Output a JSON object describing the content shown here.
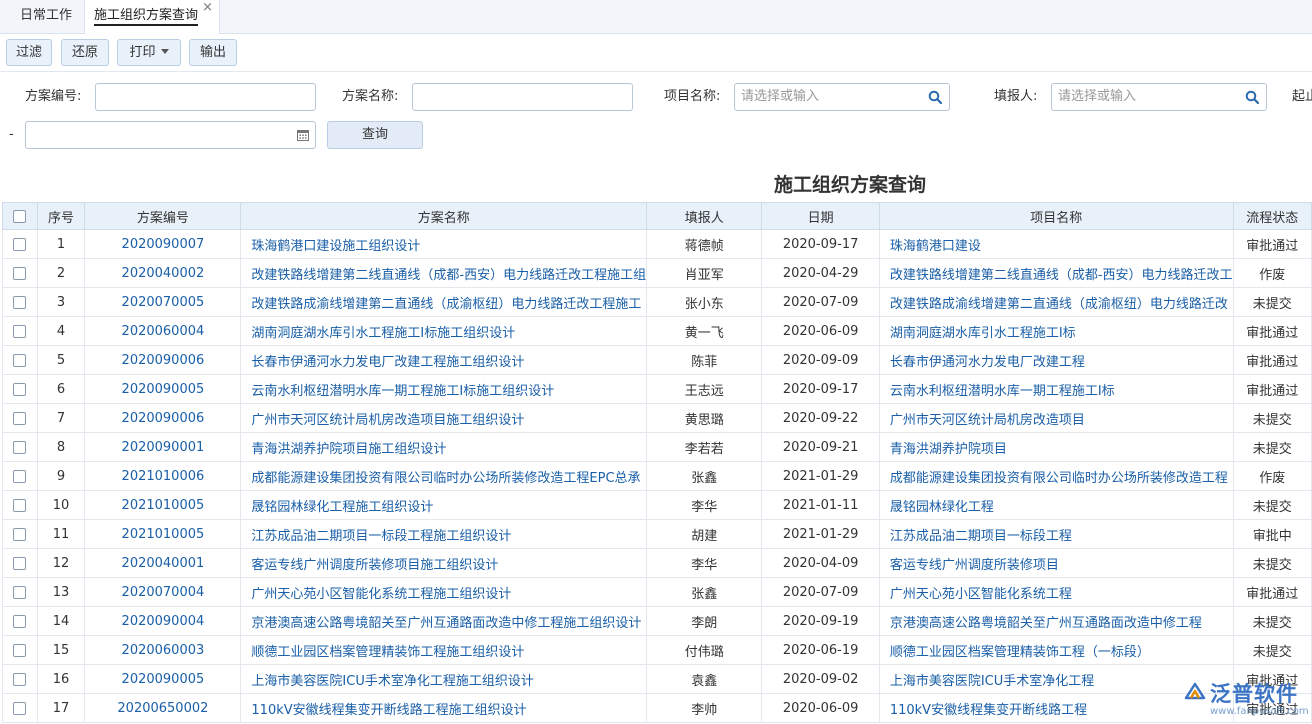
{
  "tabs": [
    {
      "label": "日常工作"
    },
    {
      "label": "施工组织方案查询",
      "close": "×"
    }
  ],
  "toolbar": {
    "filter": "过滤",
    "reset": "还原",
    "print": "打印",
    "output": "输出"
  },
  "form": {
    "plan_no_label": "方案编号:",
    "plan_name_label": "方案名称:",
    "project_label": "项目名称:",
    "project_placeholder": "请选择或输入",
    "reporter_label": "填报人:",
    "reporter_placeholder": "请选择或输入",
    "start_label": "起止",
    "dash": "-",
    "query": "查询"
  },
  "title": "施工组织方案查询",
  "columns": [
    "序号",
    "方案编号",
    "方案名称",
    "填报人",
    "日期",
    "项目名称",
    "流程状态"
  ],
  "rows": [
    {
      "no": "1",
      "code": "2020090007",
      "name": "珠海鹤港口建设施工组织设计",
      "reporter": "蒋德帧",
      "date": "2020-09-17",
      "project": "珠海鹤港口建设",
      "status": "审批通过",
      "status_type": "approved"
    },
    {
      "no": "2",
      "code": "2020040002",
      "name": "改建铁路线增建第二线直通线（成都-西安）电力线路迁改工程施工组",
      "reporter": "肖亚军",
      "date": "2020-04-29",
      "project": "改建铁路线增建第二线直通线（成都-西安）电力线路迁改工",
      "status": "作废",
      "status_type": "void"
    },
    {
      "no": "3",
      "code": "2020070005",
      "name": "改建铁路成渝线增建第二直通线（成渝枢纽）电力线路迁改工程施工",
      "reporter": "张小东",
      "date": "2020-07-09",
      "project": "改建铁路成渝线增建第二直通线（成渝枢纽）电力线路迁改",
      "status": "未提交",
      "status_type": "unsub"
    },
    {
      "no": "4",
      "code": "2020060004",
      "name": "湖南洞庭湖水库引水工程施工I标施工组织设计",
      "reporter": "黄一飞",
      "date": "2020-06-09",
      "project": "湖南洞庭湖水库引水工程施工I标",
      "status": "审批通过",
      "status_type": "approved"
    },
    {
      "no": "5",
      "code": "2020090006",
      "name": "长春市伊通河水力发电厂改建工程施工组织设计",
      "reporter": "陈菲",
      "date": "2020-09-09",
      "project": "长春市伊通河水力发电厂改建工程",
      "status": "审批通过",
      "status_type": "approved"
    },
    {
      "no": "6",
      "code": "2020090005",
      "name": "云南水利枢纽潜明水库一期工程施工I标施工组织设计",
      "reporter": "王志远",
      "date": "2020-09-17",
      "project": "云南水利枢纽潜明水库一期工程施工I标",
      "status": "审批通过",
      "status_type": "approved"
    },
    {
      "no": "7",
      "code": "2020090006",
      "name": "广州市天河区统计局机房改造项目施工组织设计",
      "reporter": "黄思璐",
      "date": "2020-09-22",
      "project": "广州市天河区统计局机房改造项目",
      "status": "未提交",
      "status_type": "unsub"
    },
    {
      "no": "8",
      "code": "2020090001",
      "name": "青海洪湖养护院项目施工组织设计",
      "reporter": "李若若",
      "date": "2020-09-21",
      "project": "青海洪湖养护院项目",
      "status": "未提交",
      "status_type": "unsub"
    },
    {
      "no": "9",
      "code": "2021010006",
      "name": "成都能源建设集团投资有限公司临时办公场所装修改造工程EPC总承",
      "reporter": "张鑫",
      "date": "2021-01-29",
      "project": "成都能源建设集团投资有限公司临时办公场所装修改造工程",
      "status": "作废",
      "status_type": "void"
    },
    {
      "no": "10",
      "code": "2021010005",
      "name": "晟铭园林绿化工程施工组织设计",
      "reporter": "李华",
      "date": "2021-01-11",
      "project": "晟铭园林绿化工程",
      "status": "未提交",
      "status_type": "unsub"
    },
    {
      "no": "11",
      "code": "2021010005",
      "name": "江苏成品油二期项目一标段工程施工组织设计",
      "reporter": "胡建",
      "date": "2021-01-29",
      "project": "江苏成品油二期项目一标段工程",
      "status": "审批中",
      "status_type": "pending"
    },
    {
      "no": "12",
      "code": "2020040001",
      "name": "客运专线广州调度所装修项目施工组织设计",
      "reporter": "李华",
      "date": "2020-04-09",
      "project": "客运专线广州调度所装修项目",
      "status": "未提交",
      "status_type": "unsub"
    },
    {
      "no": "13",
      "code": "2020070004",
      "name": "广州天心苑小区智能化系统工程施工组织设计",
      "reporter": "张鑫",
      "date": "2020-07-09",
      "project": "广州天心苑小区智能化系统工程",
      "status": "审批通过",
      "status_type": "approved"
    },
    {
      "no": "14",
      "code": "2020090004",
      "name": "京港澳高速公路粤境韶关至广州互通路面改造中修工程施工组织设计",
      "reporter": "李朗",
      "date": "2020-09-19",
      "project": "京港澳高速公路粤境韶关至广州互通路面改造中修工程",
      "status": "未提交",
      "status_type": "unsub"
    },
    {
      "no": "15",
      "code": "2020060003",
      "name": "顺德工业园区档案管理精装饰工程施工组织设计",
      "reporter": "付伟璐",
      "date": "2020-06-19",
      "project": "顺德工业园区档案管理精装饰工程（一标段）",
      "status": "未提交",
      "status_type": "unsub"
    },
    {
      "no": "16",
      "code": "2020090005",
      "name": "上海市美容医院ICU手术室净化工程施工组织设计",
      "reporter": "袁鑫",
      "date": "2020-09-02",
      "project": "上海市美容医院ICU手术室净化工程",
      "status": "审批通过",
      "status_type": "approved"
    },
    {
      "no": "17",
      "code": "20200650002",
      "name": "110kV安徽线程集变开断线路工程施工组织设计",
      "reporter": "李帅",
      "date": "2020-06-09",
      "project": "110kV安徽线程集变开断线路工程",
      "status": "审批通过",
      "status_type": "approved"
    }
  ],
  "watermark": {
    "text": "泛普软件",
    "url": "www.fanpusoft.com"
  },
  "colors": {
    "link": "#1a5fa8",
    "approved": "#2f8a2f",
    "void": "#c9302c",
    "unsubmitted": "#3a2fb8",
    "pending": "#e08a00",
    "header_bg": "#e8f0f9"
  }
}
